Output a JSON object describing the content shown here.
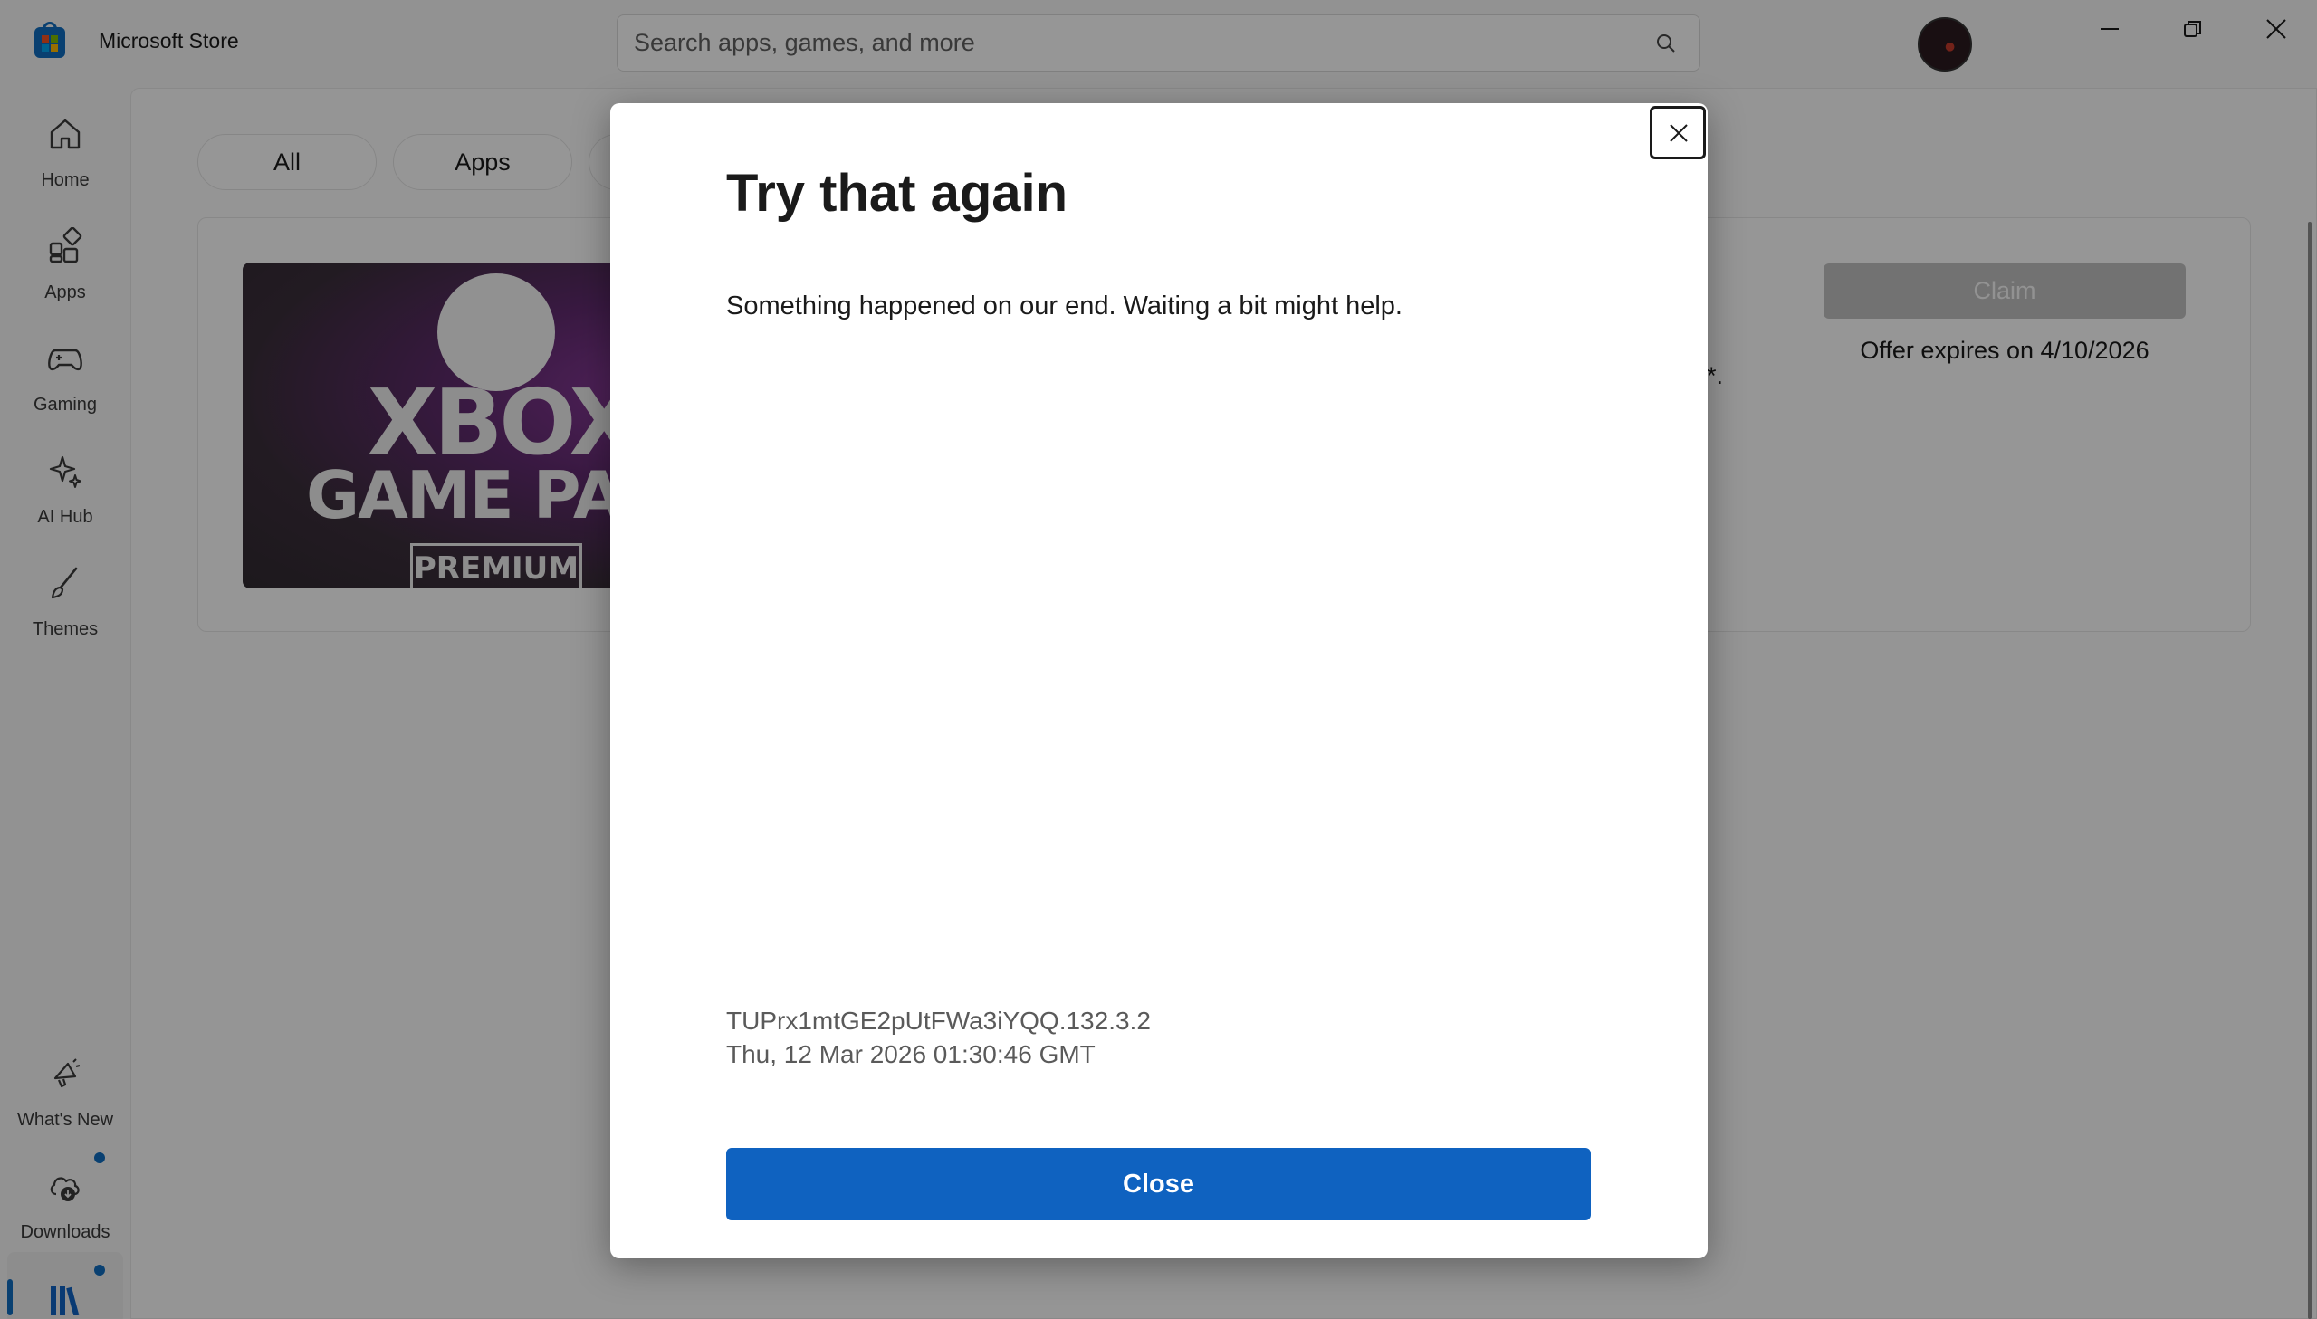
{
  "window": {
    "app_title": "Microsoft Store",
    "search_placeholder": "Search apps, games, and more",
    "search_value": "",
    "icons": {
      "app_logo": "store-bag-icon",
      "search": "search-icon",
      "minimize": "minimize-icon",
      "restore": "restore-icon",
      "close": "close-icon"
    }
  },
  "sidebar": {
    "items": [
      {
        "label": "Home",
        "icon": "home-icon"
      },
      {
        "label": "Apps",
        "icon": "apps-icon"
      },
      {
        "label": "Gaming",
        "icon": "gamepad-icon"
      },
      {
        "label": "AI Hub",
        "icon": "sparkle-icon"
      },
      {
        "label": "Themes",
        "icon": "brush-icon"
      },
      {
        "label": "What's New",
        "icon": "megaphone-icon"
      },
      {
        "label": "Downloads",
        "icon": "cloud-download-icon"
      },
      {
        "label": "",
        "icon": "library-icon"
      }
    ]
  },
  "filters": {
    "pills": [
      "All",
      "Apps"
    ]
  },
  "offer": {
    "image_text_line1": "XBOX",
    "image_text_line2": "GAME PAS",
    "image_badge": "PREMIUM",
    "claim_label": "Claim",
    "expires": "Offer expires on 4/10/2026",
    "partial_text": "*."
  },
  "dialog": {
    "title": "Try that again",
    "message": "Something happened on our end. Waiting a bit might help.",
    "error_code": "TUPrx1mtGE2pUtFWa3iYQQ.132.3.2",
    "error_time": "Thu, 12 Mar 2026 01:30:46 GMT",
    "close_label": "Close"
  },
  "colors": {
    "accent": "#0f62c0",
    "overlay": "rgba(0,0,0,0.40)",
    "claim_disabled": "#bfbfbf"
  }
}
